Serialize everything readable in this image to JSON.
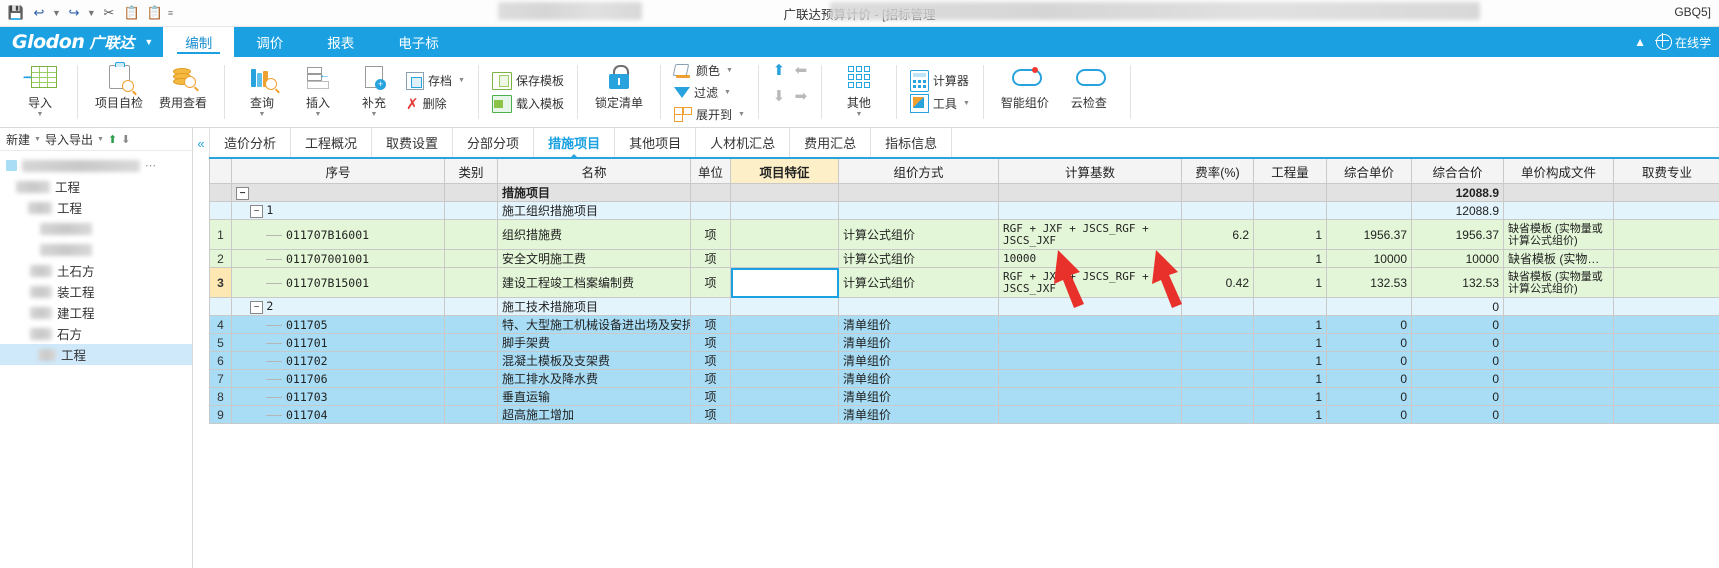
{
  "titlebar": {
    "doc_title": "广联达预算计价 - [招标管理",
    "right_label": "GBQ5]",
    "quick_access": [
      "save-icon",
      "undo-icon",
      "redo-icon",
      "cut-icon",
      "copy-icon",
      "paste-icon",
      "more-icon"
    ]
  },
  "brand": {
    "name_en": "Glodon",
    "name_cn": "广联达"
  },
  "ribbon_tabs": [
    {
      "label": "编制",
      "active": true
    },
    {
      "label": "调价",
      "active": false
    },
    {
      "label": "报表",
      "active": false
    },
    {
      "label": "电子标",
      "active": false
    }
  ],
  "ribbon_right": {
    "online_label": "在线学"
  },
  "ribbon": {
    "groups": [
      {
        "buttons": [
          {
            "label": "导入",
            "icon": "import-table-icon",
            "dropdown": true
          }
        ]
      },
      {
        "buttons": [
          {
            "label": "项目自检",
            "icon": "project-check-icon",
            "dropdown": false
          },
          {
            "label": "费用查看",
            "icon": "cost-view-icon",
            "dropdown": false
          }
        ]
      },
      {
        "buttons": [
          {
            "label": "查询",
            "icon": "query-books-icon",
            "dropdown": true
          },
          {
            "label": "插入",
            "icon": "insert-row-icon",
            "dropdown": true
          },
          {
            "label": "补充",
            "icon": "supplement-doc-icon",
            "dropdown": true
          }
        ],
        "small": [
          {
            "label": "存档",
            "icon": "archive-icon",
            "dropdown": true
          },
          {
            "label": "删除",
            "icon": "delete-x-icon",
            "dropdown": false
          }
        ]
      },
      {
        "small": [
          {
            "label": "保存模板",
            "icon": "save-template-icon",
            "dropdown": false
          },
          {
            "label": "载入模板",
            "icon": "load-template-icon",
            "dropdown": false
          }
        ]
      },
      {
        "buttons": [
          {
            "label": "锁定清单",
            "icon": "lock-icon",
            "dropdown": false
          }
        ]
      },
      {
        "small": [
          {
            "label": "颜色",
            "icon": "paint-bucket-icon",
            "dropdown": true
          },
          {
            "label": "过滤",
            "icon": "filter-funnel-icon",
            "dropdown": true
          },
          {
            "label": "展开到",
            "icon": "expand-to-icon",
            "dropdown": true
          }
        ]
      },
      {
        "arrows": [
          "arrow-up-icon",
          "arrow-left-icon",
          "arrow-down-icon",
          "arrow-right-icon"
        ]
      },
      {
        "buttons": [
          {
            "label": "其他",
            "icon": "grid-nine-icon",
            "dropdown": true
          }
        ]
      },
      {
        "small": [
          {
            "label": "计算器",
            "icon": "calculator-icon",
            "dropdown": false
          },
          {
            "label": "工具",
            "icon": "tools-icon",
            "dropdown": true
          }
        ]
      },
      {
        "buttons": [
          {
            "label": "智能组价",
            "icon": "cloud-smart-price-icon",
            "dropdown": false
          },
          {
            "label": "云检查",
            "icon": "cloud-check-icon",
            "dropdown": false
          }
        ]
      }
    ]
  },
  "left_pane": {
    "header": {
      "new_label": "新建",
      "import_export_label": "导入导出",
      "up_icon": "arrow-up-icon",
      "down_icon": "arrow-down-icon"
    },
    "tree": [
      {
        "label": "",
        "blurred": true,
        "indent": 0,
        "selected": false,
        "has_square": true
      },
      {
        "label": "工程",
        "blurred": true,
        "indent": 1,
        "selected": false
      },
      {
        "label": "工程",
        "blurred": true,
        "indent": 2,
        "selected": false
      },
      {
        "label": "",
        "blurred": true,
        "indent": 3,
        "selected": false
      },
      {
        "label": "",
        "blurred": true,
        "indent": 3,
        "selected": false
      },
      {
        "label": "土石方",
        "blurred": true,
        "indent": 3,
        "selected": false
      },
      {
        "label": "装工程",
        "blurred": true,
        "indent": 3,
        "selected": false
      },
      {
        "label": "建工程",
        "blurred": true,
        "indent": 3,
        "selected": false
      },
      {
        "label": "石方",
        "blurred": true,
        "indent": 3,
        "selected": false
      },
      {
        "label": "工程",
        "blurred": true,
        "indent": 3,
        "selected": true
      }
    ]
  },
  "data_tabs": [
    {
      "label": "造价分析",
      "active": false
    },
    {
      "label": "工程概况",
      "active": false
    },
    {
      "label": "取费设置",
      "active": false
    },
    {
      "label": "分部分项",
      "active": false
    },
    {
      "label": "措施项目",
      "active": true
    },
    {
      "label": "其他项目",
      "active": false
    },
    {
      "label": "人材机汇总",
      "active": false
    },
    {
      "label": "费用汇总",
      "active": false
    },
    {
      "label": "指标信息",
      "active": false
    }
  ],
  "table": {
    "columns": [
      "序号",
      "类别",
      "名称",
      "单位",
      "项目特征",
      "组价方式",
      "计算基数",
      "费率(%)",
      "工程量",
      "综合单价",
      "综合合价",
      "单价构成文件",
      "取费专业"
    ],
    "highlight_column": "项目特征",
    "rows": [
      {
        "rowno": "",
        "level": "lvl0",
        "expander": "−",
        "indent": 0,
        "seq": "",
        "category": "",
        "name": "措施项目",
        "unit": "",
        "feature": "",
        "price_mode": "",
        "calc_base": "",
        "rate": "",
        "qty": "",
        "unit_price": "",
        "total_price": "12088.9",
        "price_file": "",
        "specialty": ""
      },
      {
        "rowno": "",
        "level": "lvl1",
        "expander": "−",
        "indent": 1,
        "seq": "1",
        "category": "",
        "name": "施工组织措施项目",
        "unit": "",
        "feature": "",
        "price_mode": "",
        "calc_base": "",
        "rate": "",
        "qty": "",
        "unit_price": "",
        "total_price": "12088.9",
        "price_file": "",
        "specialty": ""
      },
      {
        "rowno": "1",
        "level": "green",
        "expander": "",
        "indent": 2,
        "seq": "011707B16001",
        "category": "",
        "name": "组织措施费",
        "unit": "项",
        "feature": "",
        "price_mode": "计算公式组价",
        "calc_base": "RGF + JXF + JSCS_RGF + JSCS_JXF",
        "rate": "6.2",
        "qty": "1",
        "unit_price": "1956.37",
        "total_price": "1956.37",
        "price_file": "缺省模板 (实物量或计算公式组价)",
        "specialty": ""
      },
      {
        "rowno": "2",
        "level": "green",
        "expander": "",
        "indent": 2,
        "seq": "011707001001",
        "category": "",
        "name": "安全文明施工费",
        "unit": "项",
        "feature": "",
        "price_mode": "计算公式组价",
        "calc_base": "10000",
        "rate": "",
        "qty": "1",
        "unit_price": "10000",
        "total_price": "10000",
        "price_file": "缺省模板 (实物…",
        "specialty": ""
      },
      {
        "rowno": "3",
        "level": "green",
        "current": true,
        "expander": "",
        "indent": 2,
        "seq": "011707B15001",
        "category": "",
        "name": "建设工程竣工档案编制费",
        "unit": "项",
        "feature": "",
        "feature_selected": true,
        "price_mode": "计算公式组价",
        "calc_base": "RGF + JXF + JSCS_RGF + JSCS_JXF",
        "rate": "0.42",
        "qty": "1",
        "unit_price": "132.53",
        "total_price": "132.53",
        "price_file": "缺省模板 (实物量或计算公式组价)",
        "specialty": ""
      },
      {
        "rowno": "",
        "level": "lvl1",
        "expander": "−",
        "indent": 1,
        "seq": "2",
        "category": "",
        "name": "施工技术措施项目",
        "unit": "",
        "feature": "",
        "price_mode": "",
        "calc_base": "",
        "rate": "",
        "qty": "",
        "unit_price": "",
        "total_price": "0",
        "price_file": "",
        "specialty": ""
      },
      {
        "rowno": "4",
        "level": "blue",
        "expander": "",
        "indent": 2,
        "seq": "011705",
        "category": "",
        "name": "特、大型施工机械设备进出场及安拆费",
        "unit": "项",
        "feature": "",
        "price_mode": "清单组价",
        "calc_base": "",
        "rate": "",
        "qty": "1",
        "unit_price": "0",
        "total_price": "0",
        "price_file": "",
        "specialty": ""
      },
      {
        "rowno": "5",
        "level": "blue",
        "expander": "",
        "indent": 2,
        "seq": "011701",
        "category": "",
        "name": "脚手架费",
        "unit": "项",
        "feature": "",
        "price_mode": "清单组价",
        "calc_base": "",
        "rate": "",
        "qty": "1",
        "unit_price": "0",
        "total_price": "0",
        "price_file": "",
        "specialty": ""
      },
      {
        "rowno": "6",
        "level": "blue",
        "expander": "",
        "indent": 2,
        "seq": "011702",
        "category": "",
        "name": "混凝土模板及支架费",
        "unit": "项",
        "feature": "",
        "price_mode": "清单组价",
        "calc_base": "",
        "rate": "",
        "qty": "1",
        "unit_price": "0",
        "total_price": "0",
        "price_file": "",
        "specialty": ""
      },
      {
        "rowno": "7",
        "level": "blue",
        "expander": "",
        "indent": 2,
        "seq": "011706",
        "category": "",
        "name": "施工排水及降水费",
        "unit": "项",
        "feature": "",
        "price_mode": "清单组价",
        "calc_base": "",
        "rate": "",
        "qty": "1",
        "unit_price": "0",
        "total_price": "0",
        "price_file": "",
        "specialty": ""
      },
      {
        "rowno": "8",
        "level": "blue",
        "expander": "",
        "indent": 2,
        "seq": "011703",
        "category": "",
        "name": "垂直运输",
        "unit": "项",
        "feature": "",
        "price_mode": "清单组价",
        "calc_base": "",
        "rate": "",
        "qty": "1",
        "unit_price": "0",
        "total_price": "0",
        "price_file": "",
        "specialty": ""
      },
      {
        "rowno": "9",
        "level": "blue",
        "expander": "",
        "indent": 2,
        "seq": "011704",
        "category": "",
        "name": "超高施工增加",
        "unit": "项",
        "feature": "",
        "price_mode": "清单组价",
        "calc_base": "",
        "rate": "",
        "qty": "1",
        "unit_price": "0",
        "total_price": "0",
        "price_file": "",
        "specialty": ""
      }
    ]
  },
  "annotations": [
    {
      "type": "red-arrow",
      "points_to": "calc-base-cell-row2"
    },
    {
      "type": "red-arrow",
      "points_to": "rate-cell-row2"
    }
  ],
  "colors": {
    "brand": "#1ba1e2",
    "highlight_header": "#fdf0c8",
    "row_green": "#e3f6d7",
    "row_blue": "#a8ddf5",
    "annotation_red": "#e8312a"
  }
}
